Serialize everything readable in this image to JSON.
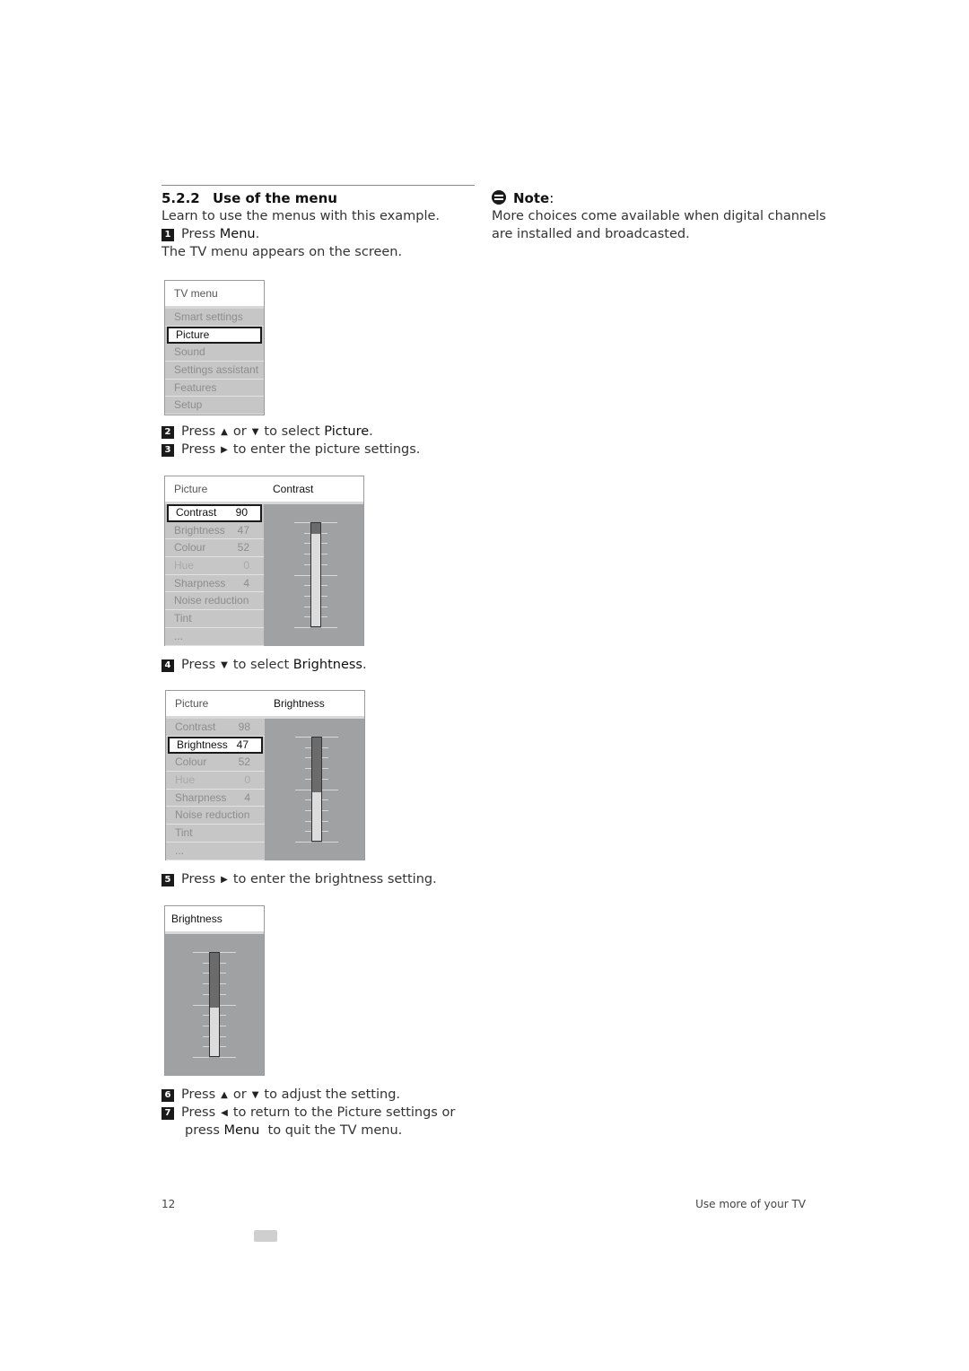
{
  "section": {
    "number": "5.2.2",
    "title": "Use of the menu",
    "intro": "Learn to use the menus with this example."
  },
  "steps": [
    {
      "num": "1",
      "pre": "Press ",
      "bold": "Menu",
      "post": "."
    },
    {
      "num": "2",
      "pre": "Press",
      "key1": "▲",
      "mid": "or",
      "key2": "▼",
      "post": "to select ",
      "bold": "Picture",
      "end": "."
    },
    {
      "num": "3",
      "pre": "Press",
      "key1": "▶",
      "post": "to enter the picture settings."
    },
    {
      "num": "4",
      "pre": "Press",
      "key1": "▼",
      "post": "to select ",
      "bold": "Brightness",
      "end": "."
    },
    {
      "num": "5",
      "pre": "Press",
      "key1": "▶",
      "post": "to enter the brightness setting."
    },
    {
      "num": "6",
      "pre": "Press",
      "key1": "▲",
      "mid": "or",
      "key2": "▼",
      "post": "to adjust the setting."
    },
    {
      "num": "7",
      "pre": "Press",
      "key1": "◀",
      "post": "to return to the Picture settings or",
      "line2_pre": "press ",
      "line2_bold": "Menu",
      "line2_post": "  to quit the TV menu."
    }
  ],
  "step1_result": "The TV menu appears on the screen.",
  "note": {
    "title": "Note",
    "colon": ":",
    "line1": "More choices come available when digital channels",
    "line2": "are installed and broadcasted."
  },
  "tv_menu": {
    "header": "TV menu",
    "items": [
      "Smart settings",
      "Picture",
      "Sound",
      "Settings assistant",
      "Features",
      "Setup"
    ],
    "selected": "Picture"
  },
  "picture_menu_contrast": {
    "header_left": "Picture",
    "header_right": "Contrast",
    "items": [
      {
        "label": "Contrast",
        "value": "90"
      },
      {
        "label": "Brightness",
        "value": "47"
      },
      {
        "label": "Colour",
        "value": "52"
      },
      {
        "label": "Hue",
        "value": "0"
      },
      {
        "label": "Sharpness",
        "value": "4"
      },
      {
        "label": "Noise reduction",
        "value": ""
      },
      {
        "label": "Tint",
        "value": ""
      },
      {
        "label": "...",
        "value": ""
      }
    ],
    "selected": "Contrast",
    "slider_level": 0.9
  },
  "picture_menu_brightness": {
    "header_left": "Picture",
    "header_right": "Brightness",
    "items": [
      {
        "label": "Contrast",
        "value": "98"
      },
      {
        "label": "Brightness",
        "value": "47"
      },
      {
        "label": "Colour",
        "value": "52"
      },
      {
        "label": "Hue",
        "value": "0"
      },
      {
        "label": "Sharpness",
        "value": "4"
      },
      {
        "label": "Noise reduction",
        "value": ""
      },
      {
        "label": "Tint",
        "value": ""
      },
      {
        "label": "...",
        "value": ""
      }
    ],
    "selected": "Brightness",
    "slider_level": 0.47
  },
  "brightness_box": {
    "header": "Brightness",
    "slider_level": 0.47
  },
  "footer": {
    "page_number": "12",
    "chapter": "Use more of your TV"
  }
}
